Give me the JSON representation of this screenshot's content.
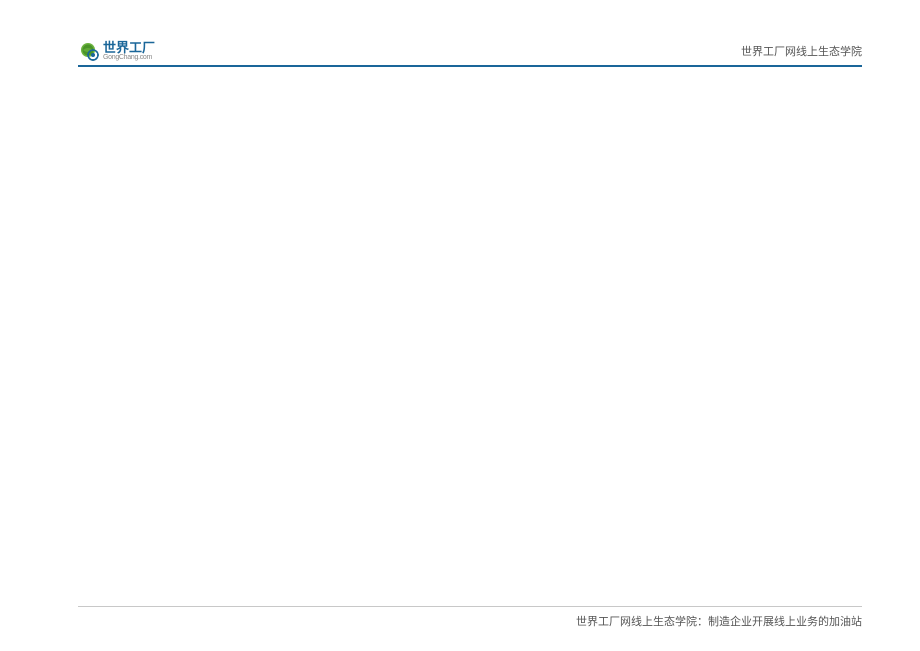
{
  "header": {
    "logo": {
      "main_text": "世界工厂",
      "sub_text": "GongChang.com"
    },
    "right_text": "世界工厂网线上生态学院"
  },
  "footer": {
    "text": "世界工厂网线上生态学院：制造企业开展线上业务的加油站"
  },
  "colors": {
    "brand_blue": "#1a6699",
    "logo_green": "#6cb33f"
  }
}
